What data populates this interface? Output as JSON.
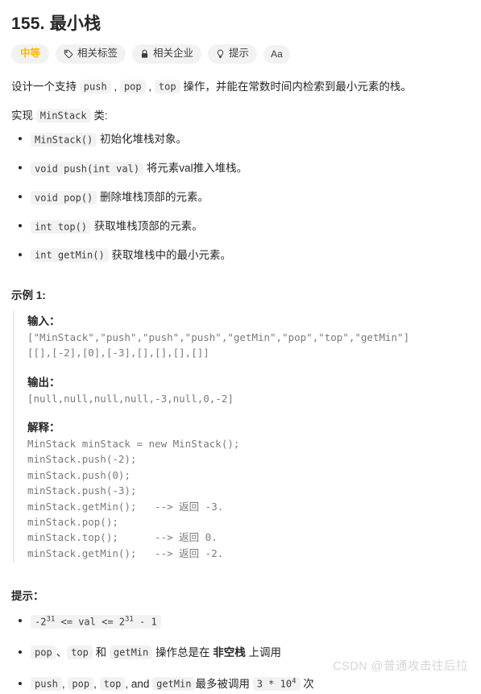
{
  "problem": {
    "title": "155. 最小栈",
    "difficulty": "中等",
    "badges": [
      {
        "label": "相关标签",
        "icon": "tag-icon"
      },
      {
        "label": "相关企业",
        "icon": "lock-icon"
      },
      {
        "label": "提示",
        "icon": "lightbulb-icon"
      }
    ],
    "font_size_button": "Aa"
  },
  "description": {
    "line1_prefix": "设计一个支持 ",
    "op_push": "push",
    "sep1": " , ",
    "op_pop": "pop",
    "sep2": " , ",
    "op_top": "top",
    "line1_suffix": " 操作，并能在常数时间内检索到最小元素的栈。",
    "line2_prefix": "实现 ",
    "class_name": "MinStack",
    "line2_suffix": " 类:"
  },
  "methods": [
    {
      "code": "MinStack()",
      "text": "初始化堆栈对象。"
    },
    {
      "code": "void push(int val)",
      "text": "将元素val推入堆栈。"
    },
    {
      "code": "void pop()",
      "text": "删除堆栈顶部的元素。"
    },
    {
      "code": "int top()",
      "text": "获取堆栈顶部的元素。"
    },
    {
      "code": "int getMin()",
      "text": "获取堆栈中的最小元素。"
    }
  ],
  "example": {
    "heading": "示例 1:",
    "input_label": "输入：",
    "input_line1": "[\"MinStack\",\"push\",\"push\",\"push\",\"getMin\",\"pop\",\"top\",\"getMin\"]",
    "input_line2": "[[],[-2],[0],[-3],[],[],[],[]]",
    "output_label": "输出：",
    "output_value": "[null,null,null,null,-3,null,0,-2]",
    "explanation_label": "解释：",
    "explanation_code": "MinStack minStack = new MinStack();\nminStack.push(-2);\nminStack.push(0);\nminStack.push(-3);\nminStack.getMin();   --> 返回 -3.\nminStack.pop();\nminStack.top();      --> 返回 0.\nminStack.getMin();   --> 返回 -2."
  },
  "hints": {
    "heading": "提示：",
    "c1": {
      "pre": "-2",
      "sup1": "31",
      "mid": " <= val <= 2",
      "sup2": "31",
      "post": " - 1"
    },
    "c2": {
      "code1": "pop",
      "t1": "、",
      "code2": "top",
      "t2": " 和 ",
      "code3": "getMin",
      "t3": " 操作总是在 ",
      "bold": "非空栈",
      "t4": " 上调用"
    },
    "c3": {
      "code1": "push",
      "t1": ", ",
      "code2": "pop",
      "t2": ", ",
      "code3": "top",
      "t3": ", and ",
      "code4": "getMin",
      "t4": "最多被调用 ",
      "count_pre": "3 * 10",
      "count_sup": "4",
      "t5": " 次"
    }
  },
  "watermark": "CSDN @普通攻击往后拉"
}
